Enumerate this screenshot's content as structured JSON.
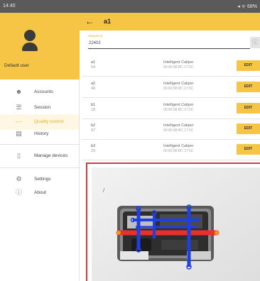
{
  "status_bar": {
    "time": "14:40",
    "right": "◂ ᯤ 68%"
  },
  "sidebar": {
    "user_name": "Default user",
    "items": [
      {
        "label": "Accounts",
        "icon": "person-icon"
      },
      {
        "label": "Session",
        "icon": "list-icon"
      },
      {
        "label": "Quality control",
        "icon": "quality-icon"
      },
      {
        "label": "History",
        "icon": "history-icon"
      },
      {
        "label": "Manage devices",
        "icon": "device-icon"
      },
      {
        "label": "Settings",
        "icon": "gear-icon"
      },
      {
        "label": "About",
        "icon": "info-icon"
      }
    ],
    "active_index": 2
  },
  "appbar": {
    "title": "a1"
  },
  "sample": {
    "label": "Sample id",
    "value": "22402"
  },
  "rows": [
    {
      "name": "a1",
      "value": "54",
      "device": "Intelligent Caliper",
      "mac": "00:80:98:BC:17:5C",
      "edit": "EDIT"
    },
    {
      "name": "a2",
      "value": "49",
      "device": "Intelligent Caliper",
      "mac": "00:80:98:BC:17:5C",
      "edit": "EDIT"
    },
    {
      "name": "b1",
      "value": "18",
      "device": "Intelligent Caliper",
      "mac": "00:80:98:BC:17:5C",
      "edit": "EDIT"
    },
    {
      "name": "b2",
      "value": "97",
      "device": "Intelligent Caliper",
      "mac": "00:80:98:BC:17:5C",
      "edit": "EDIT"
    },
    {
      "name": "b3",
      "value": "29",
      "device": "Intelligent Caliper",
      "mac": "00:80:98:BC:17:5C",
      "edit": "EDIT"
    }
  ],
  "colors": {
    "accent": "#f6c545",
    "frame": "#d73b3b",
    "measure_horizontal": "#e8312b",
    "measure_vertical": "#1f3fe0"
  }
}
